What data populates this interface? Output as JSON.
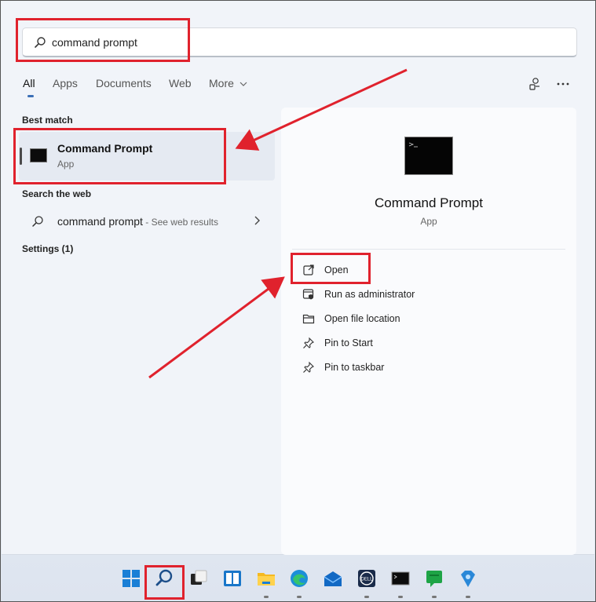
{
  "search": {
    "value": "command prompt"
  },
  "tabs": [
    {
      "label": "All",
      "active": true
    },
    {
      "label": "Apps"
    },
    {
      "label": "Documents"
    },
    {
      "label": "Web"
    },
    {
      "label": "More"
    }
  ],
  "top_icons": [
    "account-icon",
    "more-options-icon"
  ],
  "results": {
    "best_match_label": "Best match",
    "best_match": {
      "title": "Command Prompt",
      "subtitle": "App",
      "icon": "cmd-icon"
    },
    "search_web_label": "Search the web",
    "web_result": {
      "query": "command prompt",
      "hint": " - See web results",
      "icon": "search-icon"
    },
    "settings_label": "Settings (1)"
  },
  "detail": {
    "app_name": "Command Prompt",
    "app_kind": "App",
    "actions": [
      {
        "label": "Open",
        "icon": "open-external-icon"
      },
      {
        "label": "Run as administrator",
        "icon": "admin-shield-icon"
      },
      {
        "label": "Open file location",
        "icon": "folder-icon"
      },
      {
        "label": "Pin to Start",
        "icon": "pin-icon"
      },
      {
        "label": "Pin to taskbar",
        "icon": "pin-icon"
      }
    ]
  },
  "taskbar": {
    "items": [
      "start-icon",
      "search-icon",
      "task-view-icon",
      "widgets-icon",
      "file-explorer-icon",
      "edge-icon",
      "mail-icon",
      "dell-icon",
      "terminal-icon",
      "chat-icon",
      "store-icon"
    ]
  },
  "colors": {
    "annotation_red": "#e0222d",
    "accent_blue": "#3b6fb6"
  }
}
